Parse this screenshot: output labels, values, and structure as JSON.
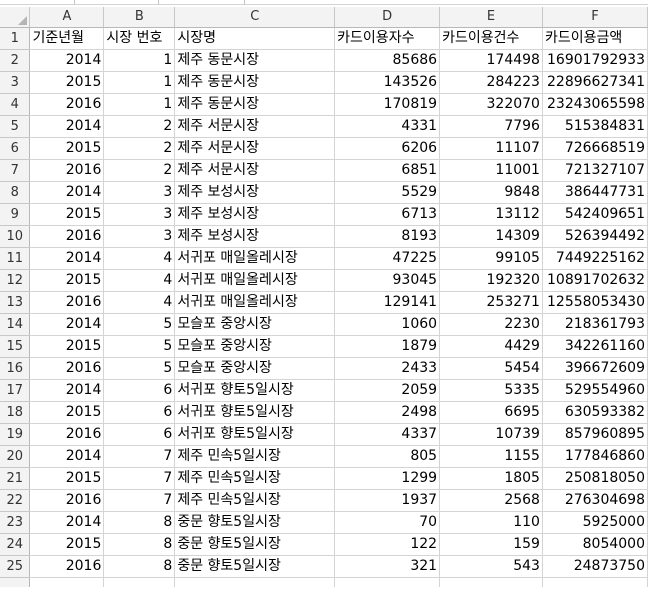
{
  "columns": [
    "A",
    "B",
    "C",
    "D",
    "E",
    "F"
  ],
  "header": [
    "기준년월",
    "시장 번호",
    "시장명",
    "카드이용자수",
    "카드이용건수",
    "카드이용금액"
  ],
  "rows": [
    {
      "n": "2",
      "c": [
        "2014",
        "1",
        "제주 동문시장",
        "85686",
        "174498",
        "16901792933"
      ]
    },
    {
      "n": "3",
      "c": [
        "2015",
        "1",
        "제주 동문시장",
        "143526",
        "284223",
        "22896627341"
      ]
    },
    {
      "n": "4",
      "c": [
        "2016",
        "1",
        "제주 동문시장",
        "170819",
        "322070",
        "23243065598"
      ]
    },
    {
      "n": "5",
      "c": [
        "2014",
        "2",
        "제주 서문시장",
        "4331",
        "7796",
        "515384831"
      ]
    },
    {
      "n": "6",
      "c": [
        "2015",
        "2",
        "제주 서문시장",
        "6206",
        "11107",
        "726668519"
      ]
    },
    {
      "n": "7",
      "c": [
        "2016",
        "2",
        "제주 서문시장",
        "6851",
        "11001",
        "721327107"
      ]
    },
    {
      "n": "8",
      "c": [
        "2014",
        "3",
        "제주 보성시장",
        "5529",
        "9848",
        "386447731"
      ]
    },
    {
      "n": "9",
      "c": [
        "2015",
        "3",
        "제주 보성시장",
        "6713",
        "13112",
        "542409651"
      ]
    },
    {
      "n": "10",
      "c": [
        "2016",
        "3",
        "제주 보성시장",
        "8193",
        "14309",
        "526394492"
      ]
    },
    {
      "n": "11",
      "c": [
        "2014",
        "4",
        "서귀포 매일올레시장",
        "47225",
        "99105",
        "7449225162"
      ]
    },
    {
      "n": "12",
      "c": [
        "2015",
        "4",
        "서귀포 매일올레시장",
        "93045",
        "192320",
        "10891702632"
      ]
    },
    {
      "n": "13",
      "c": [
        "2016",
        "4",
        "서귀포 매일올레시장",
        "129141",
        "253271",
        "12558053430"
      ]
    },
    {
      "n": "14",
      "c": [
        "2014",
        "5",
        "모슬포 중앙시장",
        "1060",
        "2230",
        "218361793"
      ]
    },
    {
      "n": "15",
      "c": [
        "2015",
        "5",
        "모슬포 중앙시장",
        "1879",
        "4429",
        "342261160"
      ]
    },
    {
      "n": "16",
      "c": [
        "2016",
        "5",
        "모슬포 중앙시장",
        "2433",
        "5454",
        "396672609"
      ]
    },
    {
      "n": "17",
      "c": [
        "2014",
        "6",
        "서귀포 향토5일시장",
        "2059",
        "5335",
        "529554960"
      ]
    },
    {
      "n": "18",
      "c": [
        "2015",
        "6",
        "서귀포 향토5일시장",
        "2498",
        "6695",
        "630593382"
      ]
    },
    {
      "n": "19",
      "c": [
        "2016",
        "6",
        "서귀포 향토5일시장",
        "4337",
        "10739",
        "857960895"
      ]
    },
    {
      "n": "20",
      "c": [
        "2014",
        "7",
        "제주 민속5일시장",
        "805",
        "1155",
        "177846860"
      ]
    },
    {
      "n": "21",
      "c": [
        "2015",
        "7",
        "제주 민속5일시장",
        "1299",
        "1805",
        "250818050"
      ]
    },
    {
      "n": "22",
      "c": [
        "2016",
        "7",
        "제주 민속5일시장",
        "1937",
        "2568",
        "276304698"
      ]
    },
    {
      "n": "23",
      "c": [
        "2014",
        "8",
        "중문 향토5일시장",
        "70",
        "110",
        "5925000"
      ]
    },
    {
      "n": "24",
      "c": [
        "2015",
        "8",
        "중문 향토5일시장",
        "122",
        "159",
        "8054000"
      ]
    },
    {
      "n": "25",
      "c": [
        "2016",
        "8",
        "중문 향토5일시장",
        "321",
        "543",
        "24873750"
      ]
    }
  ]
}
